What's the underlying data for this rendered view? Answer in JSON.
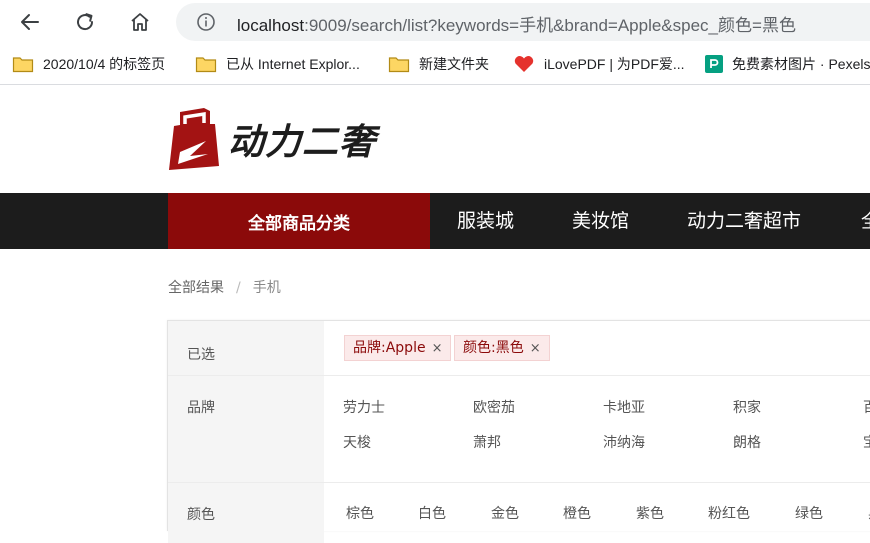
{
  "browser": {
    "url_host": "localhost",
    "url_rest": ":9009/search/list?keywords=手机&brand=Apple&spec_颜色=黑色",
    "bookmarks": [
      {
        "label": "2020/10/4 的标签页",
        "icon": "folder-icon"
      },
      {
        "label": "已从 Internet Explor...",
        "icon": "folder-icon"
      },
      {
        "label": "新建文件夹",
        "icon": "folder-icon"
      },
      {
        "label": "iLovePDF | 为PDF爱...",
        "icon": "heart-icon"
      },
      {
        "label": "免费素材图片 · Pexels",
        "icon": "pexels-icon"
      }
    ]
  },
  "header": {
    "logo_text": "动力二奢"
  },
  "nav": {
    "category": "全部商品分类",
    "links": [
      "服装城",
      "美妆馆",
      "动力二奢超市",
      "全"
    ]
  },
  "breadcrumb": {
    "root": "全部结果",
    "separator": "/",
    "current": "手机"
  },
  "filter": {
    "selected": {
      "label": "已选",
      "chips": [
        {
          "text": "品牌:Apple",
          "close": "×"
        },
        {
          "text": "颜色:黑色",
          "close": "×"
        }
      ]
    },
    "brand": {
      "label": "品牌",
      "rows": [
        [
          "劳力士",
          "欧密茄",
          "卡地亚",
          "积家",
          "百"
        ],
        [
          "天梭",
          "萧邦",
          "沛纳海",
          "朗格",
          "宝"
        ]
      ]
    },
    "color": {
      "label": "颜色",
      "options": [
        "棕色",
        "白色",
        "金色",
        "橙色",
        "紫色",
        "粉红色",
        "绿色",
        "黑"
      ]
    }
  },
  "colors": {
    "accent": "#8b0a0a",
    "nav_bg": "#1c1c1c",
    "chip_bg": "#fbeaea"
  }
}
